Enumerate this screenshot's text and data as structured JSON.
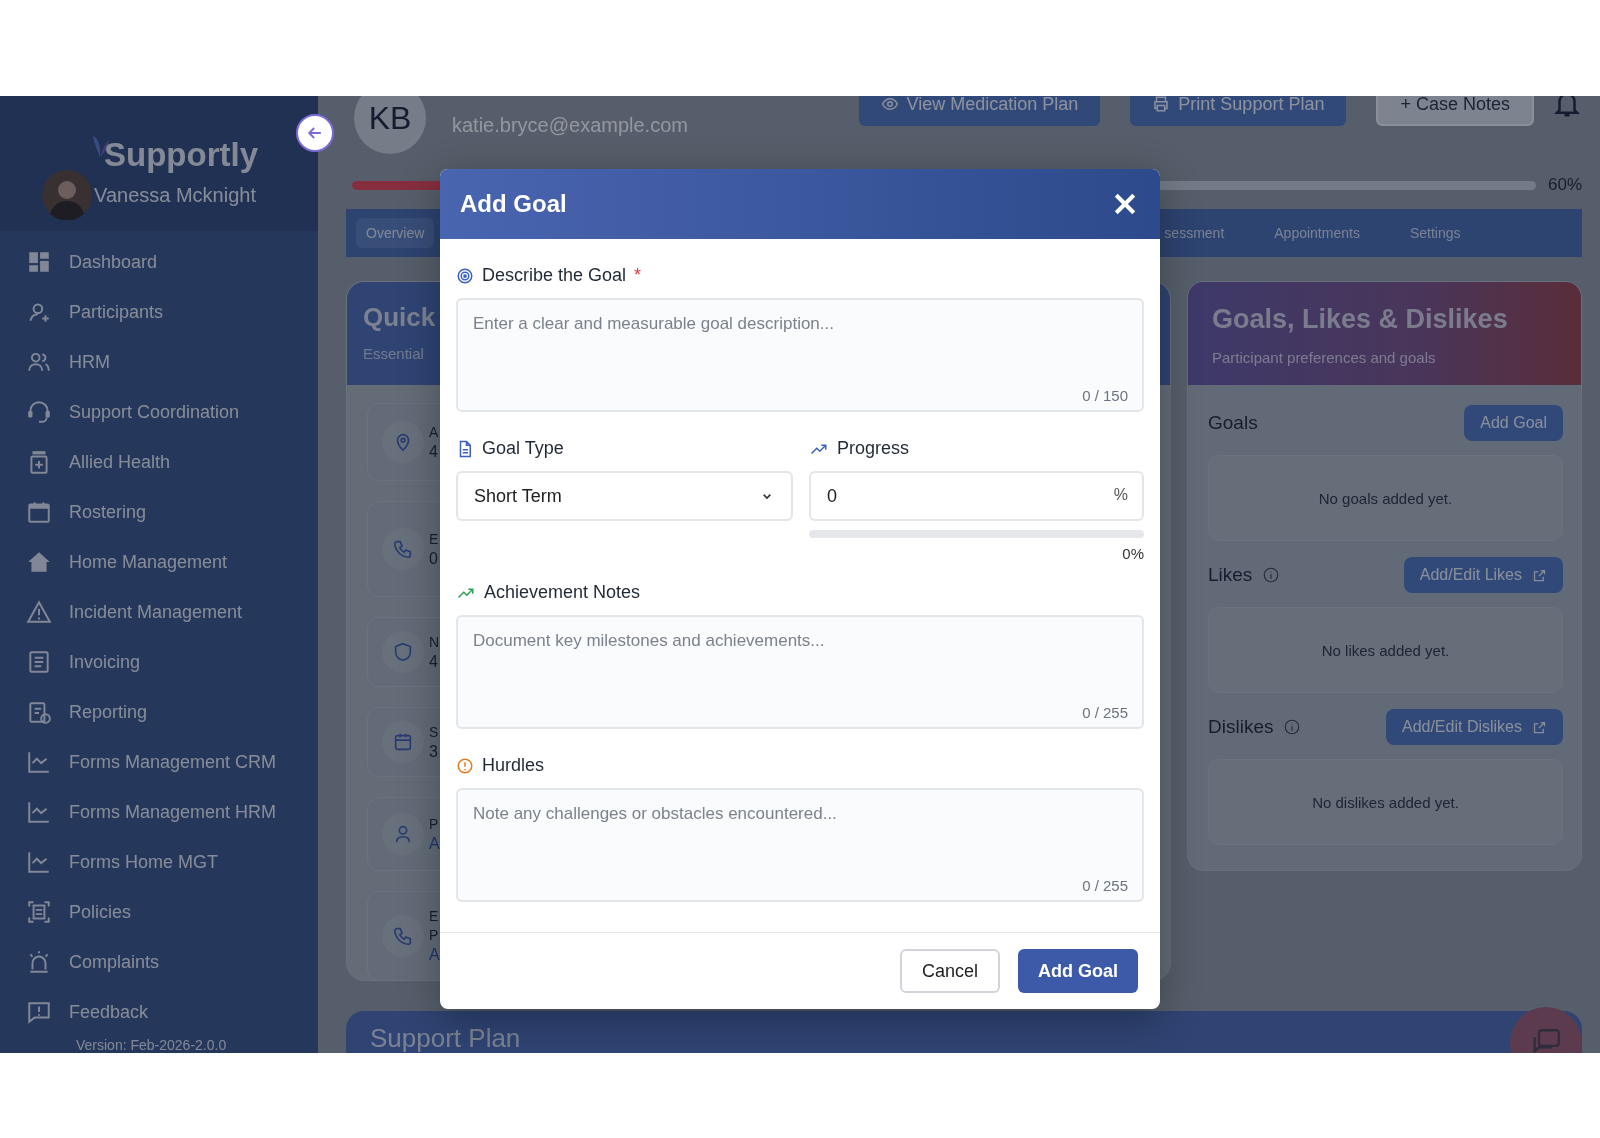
{
  "sidebar": {
    "brand": "Supportly",
    "user": "Vanessa Mcknight",
    "version": "Version: Feb-2026-2.0.0",
    "items": [
      {
        "label": "Dashboard",
        "selected": false
      },
      {
        "label": "Participants",
        "selected": false
      },
      {
        "label": "HRM",
        "selected": false
      },
      {
        "label": "Support Coordination",
        "selected": false
      },
      {
        "label": "Allied Health",
        "selected": false
      },
      {
        "label": "Rostering",
        "selected": false
      },
      {
        "label": "Home Management",
        "selected": false
      },
      {
        "label": "Incident Management",
        "selected": false
      },
      {
        "label": "Invoicing",
        "selected": false
      },
      {
        "label": "Reporting",
        "selected": false
      },
      {
        "label": "Forms Management CRM",
        "selected": false
      },
      {
        "label": "Forms Management HRM",
        "selected": false
      },
      {
        "label": "Forms Home MGT",
        "selected": false
      },
      {
        "label": "Policies",
        "selected": false
      },
      {
        "label": "Complaints",
        "selected": false
      },
      {
        "label": "Feedback",
        "selected": false
      }
    ]
  },
  "header": {
    "initials": "KB",
    "email": "katie.bryce@example.com",
    "buttons": [
      {
        "label": "View Medication Plan",
        "kind": "eye"
      },
      {
        "label": "Print Support Plan",
        "kind": "print"
      },
      {
        "label": "+ Case Notes",
        "kind": "outline"
      }
    ],
    "level": 0.6,
    "reading": "60%"
  },
  "tabs": [
    {
      "label": "Overview",
      "selected": true
    },
    {
      "label": "sessment",
      "selected": false
    },
    {
      "label": "Appointments",
      "selected": false
    },
    {
      "label": "Settings",
      "selected": false
    }
  ],
  "quick_card": {
    "title": "Quick",
    "subtitle": "Essential",
    "items": [
      {
        "label_lines": [
          "A"
        ],
        "value": "4",
        "kind": "text"
      },
      {
        "label_lines": [
          "E"
        ],
        "value": "0",
        "kind": "text"
      },
      {
        "label_lines": [
          "N"
        ],
        "value": "4",
        "kind": "text"
      },
      {
        "label_lines": [
          "S"
        ],
        "value": "3",
        "kind": "text"
      },
      {
        "label_lines": [
          "P"
        ],
        "value": "A",
        "kind": "link"
      },
      {
        "label_lines": [
          "E",
          "P"
        ],
        "value": "A",
        "kind": "link"
      }
    ]
  },
  "goals_panel": {
    "title": "Goals, Likes & Dislikes",
    "subtitle": "Participant preferences and goals",
    "sections": [
      {
        "title": "Goals",
        "info": false,
        "button": "Add Goal",
        "external": false,
        "empty": "No goals added yet."
      },
      {
        "title": "Likes",
        "info": true,
        "button": "Add/Edit Likes",
        "external": true,
        "empty": "No likes added yet."
      },
      {
        "title": "Dislikes",
        "info": true,
        "button": "Add/Edit Dislikes",
        "external": true,
        "empty": "No dislikes added yet."
      }
    ]
  },
  "support_plan": {
    "title": "Support Plan"
  },
  "modal": {
    "title": "Add Goal",
    "describe": {
      "label": "Describe the Goal",
      "required_mark": "*",
      "placeholder": "Enter a clear and measurable goal description...",
      "counter": "0 / 150"
    },
    "goal_type": {
      "label": "Goal Type",
      "value": "Short Term"
    },
    "progress": {
      "label": "Progress",
      "value": "0",
      "suffix": "%",
      "level": 0,
      "reading": "0%"
    },
    "achievement": {
      "label": "Achievement Notes",
      "placeholder": "Document key milestones and achievements...",
      "counter": "0 / 255"
    },
    "hurdles": {
      "label": "Hurdles",
      "placeholder": "Note any challenges or obstacles encountered...",
      "counter": "0 / 255"
    },
    "buttons": [
      {
        "label": "Cancel",
        "kind": "secondary"
      },
      {
        "label": "Add Goal",
        "kind": "primary"
      }
    ]
  }
}
